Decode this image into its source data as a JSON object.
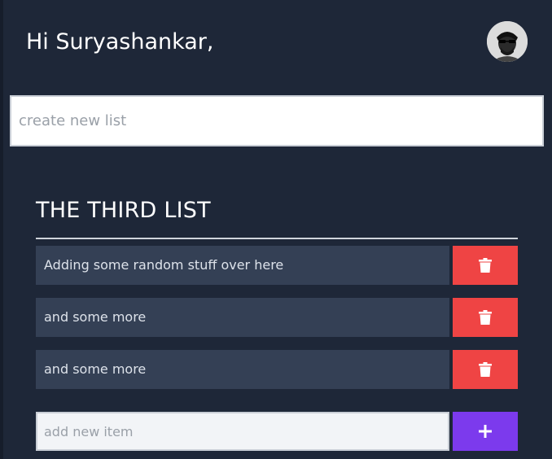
{
  "header": {
    "greeting": "Hi Suryashankar,",
    "avatar_icon": "user-avatar-icon"
  },
  "create_list": {
    "placeholder": "create new list",
    "value": ""
  },
  "list": {
    "title": "THE THIRD LIST",
    "items": [
      {
        "text": "Adding some random stuff over here"
      },
      {
        "text": "and some more"
      },
      {
        "text": "and some more"
      }
    ],
    "delete_icon": "trash-icon",
    "new_item": {
      "placeholder": "add new item",
      "value": ""
    },
    "add_icon": "plus-icon"
  },
  "colors": {
    "background": "#1e2738",
    "item_background": "#344055",
    "delete": "#ef4444",
    "add": "#7c3aed"
  }
}
